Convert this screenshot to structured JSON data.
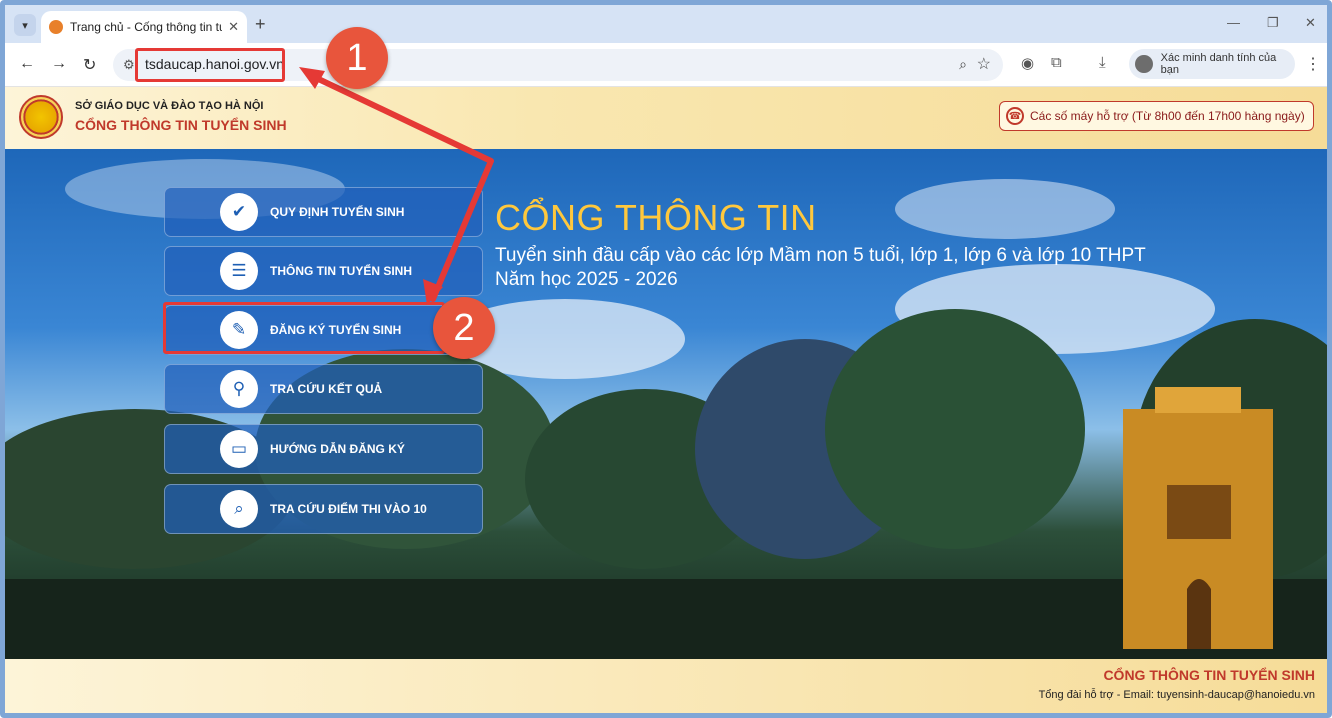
{
  "browser": {
    "tab_title": "Trang chủ - Cống thông tin tuyể",
    "url": "tsdaucap.hanoi.gov.vn",
    "profile_label": "Xác minh danh tính của bạn"
  },
  "header": {
    "org": "SỞ GIÁO DỤC VÀ ĐÀO TẠO HÀ NỘI",
    "portal": "CỔNG THÔNG TIN TUYỂN SINH",
    "support": "Các số máy hỗ trợ (Từ 8h00 đến 17h00 hàng ngày)"
  },
  "hero": {
    "title": "CỔNG THÔNG TIN",
    "subtitle": "Tuyển sinh đầu cấp vào các lớp Mầm non 5 tuổi, lớp 1, lớp 6 và lớp 10 THPT",
    "year": "Năm học 2025 - 2026"
  },
  "menu": [
    {
      "label": "QUY ĐỊNH TUYỂN SINH",
      "icon": "clipboard-check-icon"
    },
    {
      "label": "THÔNG TIN TUYỂN SINH",
      "icon": "notepad-icon"
    },
    {
      "label": "ĐĂNG KÝ TUYỂN SINH",
      "icon": "edit-document-icon"
    },
    {
      "label": "TRA CỨU KẾT QUẢ",
      "icon": "search-person-icon"
    },
    {
      "label": "HƯỚNG DẪN ĐĂNG KÝ",
      "icon": "computer-guide-icon"
    },
    {
      "label": "TRA CỨU ĐIỂM THI VÀO 10",
      "icon": "search-document-icon"
    }
  ],
  "callouts": [
    "1",
    "2"
  ],
  "footer": {
    "title": "CỔNG THÔNG TIN TUYỂN SINH",
    "contact": "Tổng đài hỗ trợ - Email: tuyensinh-daucap@hanoiedu.vn"
  }
}
